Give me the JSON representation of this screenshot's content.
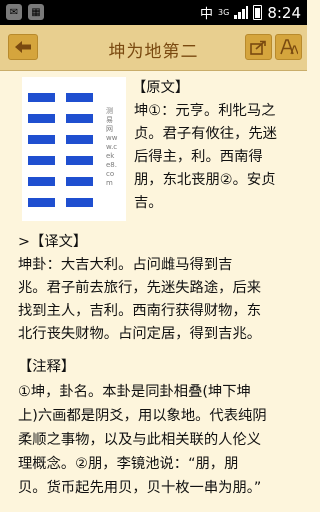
{
  "status_bar": {
    "left_icons": [
      "chat-app-icon",
      "app-grid-icon"
    ],
    "network_char": "中",
    "network_type": "3G",
    "time": "8:24"
  },
  "toolbar": {
    "title": "坤为地第二"
  },
  "hexagram_panel": {
    "watermark": "测易网 www.ceke8.com"
  },
  "content": {
    "yuanwen_heading": "【原文】",
    "yuanwen_lines": [
      "坤①：元亨。利牝马之",
      "贞。君子有攸往，先迷",
      "后得主，利。西南得",
      "朋，东北丧朋②。安贞",
      "吉。"
    ],
    "yiwen_heading": ">【译文】",
    "yiwen_lines": [
      "坤卦：大吉大利。占问雌马得到吉",
      "兆。君子前去旅行，先迷失路途，后来",
      "找到主人，吉利。西南行获得财物，东",
      "北行丧失财物。占问定居，得到吉兆。"
    ],
    "zhushi_heading": "【注释】",
    "zhushi_lines": [
      "①坤，卦名。本卦是同卦相叠(坤下坤",
      "上)六画都是阴爻，用以象地。代表纯阴",
      "柔顺之事物，以及与此相关联的人伦义",
      "理概念。②朋，李镜池说：“朋，朋",
      "贝。货币起先用贝，贝十枚一串为朋。”"
    ]
  }
}
